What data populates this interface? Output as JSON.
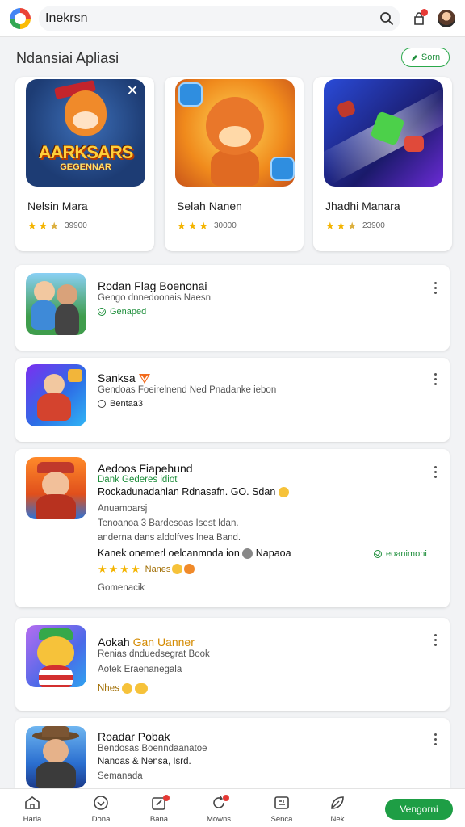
{
  "topbar": {
    "search_value": "Inekrsn",
    "icons": [
      "app-logo",
      "search-icon",
      "notification-icon",
      "avatar"
    ]
  },
  "section": {
    "title": "Ndansiai Apliasi",
    "button_label": "Sorn"
  },
  "featured": [
    {
      "name": "Nelsin Mara",
      "rating_text": "39900",
      "stars": 3,
      "art_title": "AARKSARS",
      "art_subtitle": "GEGENNAR"
    },
    {
      "name": "Selah Nanen",
      "rating_text": "30000",
      "stars": 3
    },
    {
      "name": "Jhadhi Manara",
      "rating_text": "23900",
      "stars": 3
    }
  ],
  "apps": [
    {
      "title": "Rodan Flag Boenonai",
      "subtitle": "Gengo dnnedoonais Naesn",
      "link": "Genaped"
    },
    {
      "title": "Sanksa",
      "subtitle": "Gendoas Foeirelnend Ned Pnadanke iebon",
      "link": "Bentaa3"
    },
    {
      "title": "Aedoos Fiapehund",
      "subtitle": "Dank Gederes idiot",
      "line2": "Rockadunadahlan Rdnasafn. GO. Sdan",
      "line3": "Anuamoarsj",
      "line4": "Tenoanoa 3 Bardesoas Isest Idan.",
      "line5": "anderna dans aldolfves lnea Band.",
      "line6": "Kanek onemerl oelcanmnda ion",
      "line6_tail": "Napaoa",
      "link": "eoanimoni",
      "rating_label": "Nanes",
      "footer": "Gomenacik"
    },
    {
      "title": "Aokah",
      "title_accent": "Gan Uanner",
      "subtitle": "Renias dnduedsegrat Book",
      "line2": "Aotek Eraenanegala",
      "tag": "Nhes"
    },
    {
      "title": "Roadar Pobak",
      "subtitle": "Bendosas Boenndaanatoe",
      "line2": "Nanoas & Nensa, Isrd.",
      "line3": "Semanada"
    }
  ],
  "bottomnav": {
    "items": [
      "Harla",
      "Dona",
      "Bana",
      "Mowns",
      "Senca",
      "Nek"
    ],
    "cta": "Vengorni"
  },
  "colors": {
    "accent_green": "#1e9e45",
    "star_yellow": "#f4b400",
    "badge_red": "#e53935"
  }
}
